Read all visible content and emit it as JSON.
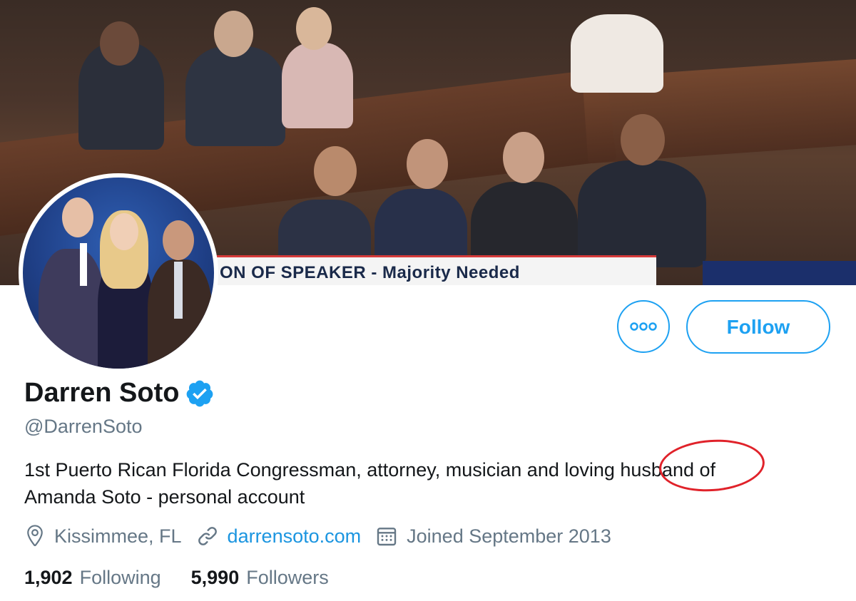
{
  "banner": {
    "caption": "ON OF SPEAKER - Majority Needed"
  },
  "actions": {
    "follow_label": "Follow"
  },
  "profile": {
    "name": "Darren Soto",
    "handle": "@DarrenSoto",
    "bio_line1": "1st Puerto Rican Florida Congressman, attorney, musician and loving husband of",
    "bio_line2": "Amanda Soto - personal account",
    "location": "Kissimmee, FL",
    "website": "darrensoto.com",
    "joined": "Joined September 2013"
  },
  "stats": {
    "following_count": "1,902",
    "following_label": "Following",
    "followers_count": "5,990",
    "followers_label": "Followers"
  },
  "colors": {
    "accent": "#1da1f2",
    "secondary_text": "#657786",
    "annotation": "#e0222a"
  },
  "icons": {
    "more": "more-icon",
    "verified": "verified-badge-icon",
    "location": "location-pin-icon",
    "link": "link-icon",
    "calendar": "calendar-icon"
  }
}
